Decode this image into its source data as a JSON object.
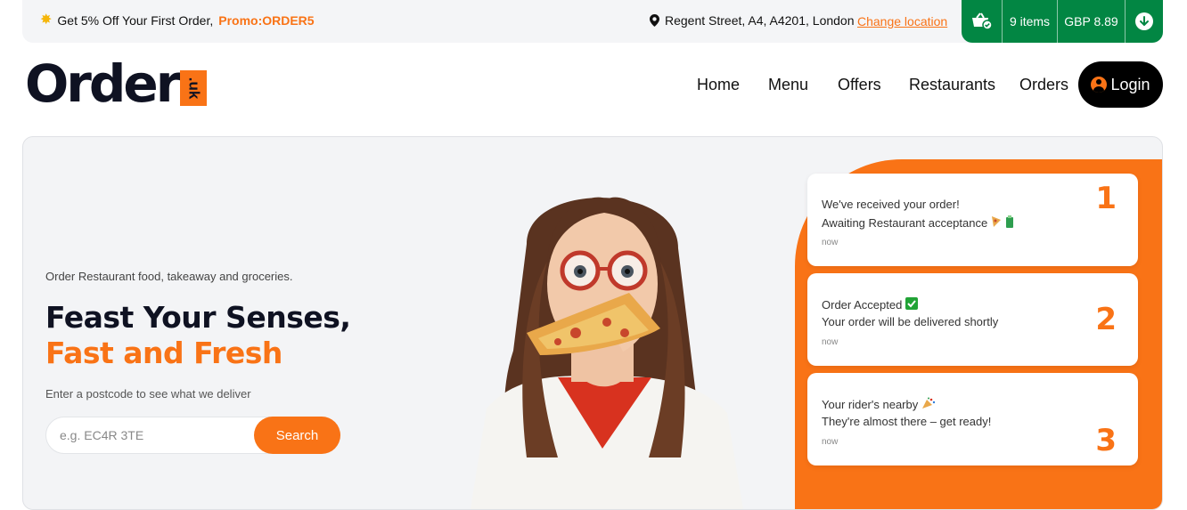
{
  "topbar": {
    "promo_text": "Get 5% Off Your First Order,",
    "promo_code": "Promo:ORDER5",
    "location": "Regent Street, A4, A4201, London",
    "change_location": "Change location"
  },
  "cart": {
    "items": "9 items",
    "total": "GBP 8.89"
  },
  "logo": {
    "brand": "Order",
    "suffix": ".uk"
  },
  "nav": {
    "home": "Home",
    "menu": "Menu",
    "offers": "Offers",
    "restaurants": "Restaurants",
    "orders": "Orders",
    "login": "Login"
  },
  "hero": {
    "tagline": "Order Restaurant food, takeaway and groceries.",
    "headline_1": "Feast Your Senses,",
    "headline_2": "Fast and Fresh",
    "subtitle": "Enter a postcode to see what we deliver",
    "search_placeholder": "e.g. EC4R 3TE",
    "search_button": "Search"
  },
  "notifications": [
    {
      "line1": "We've received your order!",
      "line2": "Awaiting Restaurant acceptance",
      "time": "now",
      "number": "1"
    },
    {
      "line1": "Order Accepted",
      "line2": "Your order will be delivered shortly",
      "time": "now",
      "number": "2"
    },
    {
      "line1": "Your rider's nearby",
      "line2": "They're almost there – get ready!",
      "time": "now",
      "number": "3"
    }
  ],
  "colors": {
    "accent": "#f97316",
    "cart_green": "#028643",
    "dark": "#0f1222"
  }
}
